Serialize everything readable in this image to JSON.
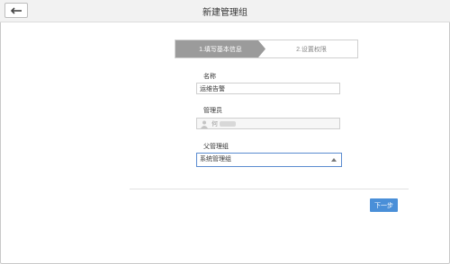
{
  "header": {
    "title": "新建管理组",
    "back_icon": "arrow-left-icon"
  },
  "steps": {
    "step1": "1.填写基本信息",
    "step2": "2.设置权限"
  },
  "form": {
    "name_label": "名称",
    "name_value": "运维告警",
    "admin_label": "管理员",
    "admin_value": "何",
    "parent_label": "父管理组",
    "parent_value": "系统管理组"
  },
  "footer": {
    "next_label": "下一步"
  },
  "colors": {
    "accent": "#4a8fd8",
    "step_active": "#9b9b9b"
  }
}
